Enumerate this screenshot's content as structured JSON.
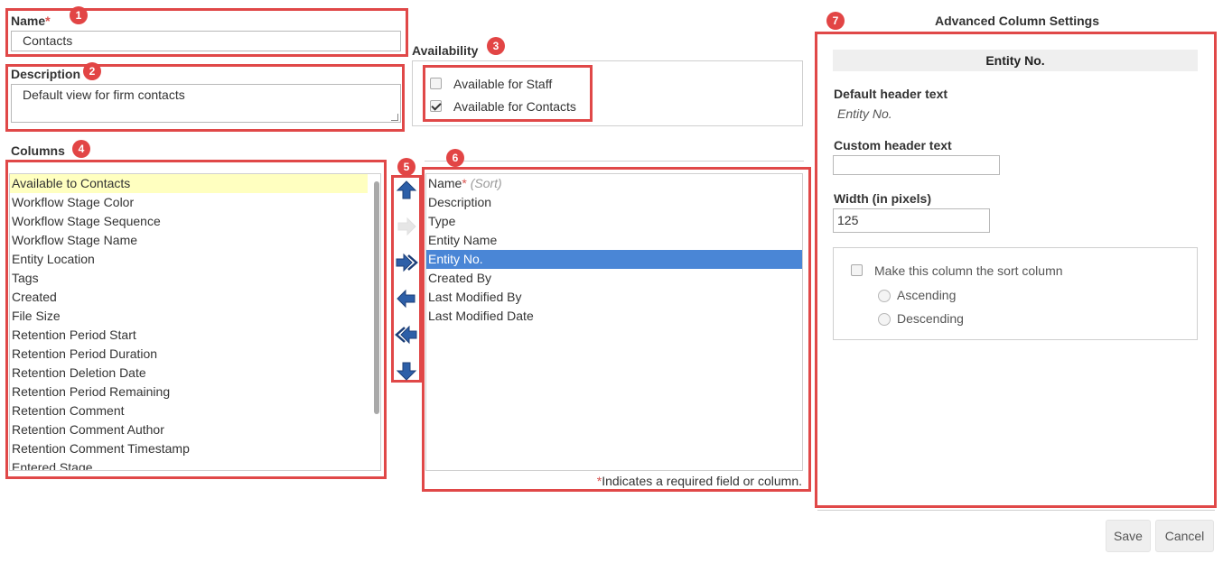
{
  "name": {
    "label": "Name",
    "required_mark": "*",
    "value": "Contacts",
    "badge": "1"
  },
  "description": {
    "label": "Description",
    "value": "Default view for firm contacts",
    "badge": "2"
  },
  "availability": {
    "label": "Availability",
    "badge": "3",
    "options": [
      {
        "label": "Available for Staff",
        "checked": false
      },
      {
        "label": "Available for Contacts",
        "checked": true
      }
    ]
  },
  "columns": {
    "label": "Columns",
    "badge": "4",
    "available": [
      "Available to Contacts",
      "Workflow Stage Color",
      "Workflow Stage Sequence",
      "Workflow Stage Name",
      "Entity Location",
      "Tags",
      "Created",
      "File Size",
      "Retention Period Start",
      "Retention Period Duration",
      "Retention Deletion Date",
      "Retention Period Remaining",
      "Retention Comment",
      "Retention Comment Author",
      "Retention Comment Timestamp",
      "Entered Stage"
    ],
    "highlighted_index": 0
  },
  "move_controls": {
    "badge": "5",
    "buttons": [
      "move-up-icon",
      "add-disabled-icon",
      "add-all-icon",
      "remove-icon",
      "remove-all-icon",
      "move-down-icon"
    ]
  },
  "selected_columns": {
    "badge": "6",
    "first": {
      "label": "Name",
      "required_mark": "*",
      "sort_note": "(Sort)"
    },
    "items": [
      "Description",
      "Type",
      "Entity Name",
      "Entity No.",
      "Created By",
      "Last Modified By",
      "Last Modified Date"
    ],
    "selected_index": 3,
    "footnote_mark": "*",
    "footnote": "Indicates a required field or column."
  },
  "advanced": {
    "title": "Advanced Column Settings",
    "badge": "7",
    "column_name": "Entity No.",
    "default_header_label": "Default header text",
    "default_header_value": "Entity No.",
    "custom_header_label": "Custom header text",
    "custom_header_value": "",
    "width_label": "Width (in pixels)",
    "width_value": "125",
    "sort_checkbox_label": "Make this column the sort column",
    "ascending_label": "Ascending",
    "descending_label": "Descending"
  },
  "footer": {
    "save_label": "Save",
    "cancel_label": "Cancel"
  },
  "colors": {
    "annotation_red": "#e04848",
    "selection_blue": "#4a86d6",
    "highlight_yellow": "#ffffc0",
    "arrow_blue": "#2d5fa8"
  }
}
